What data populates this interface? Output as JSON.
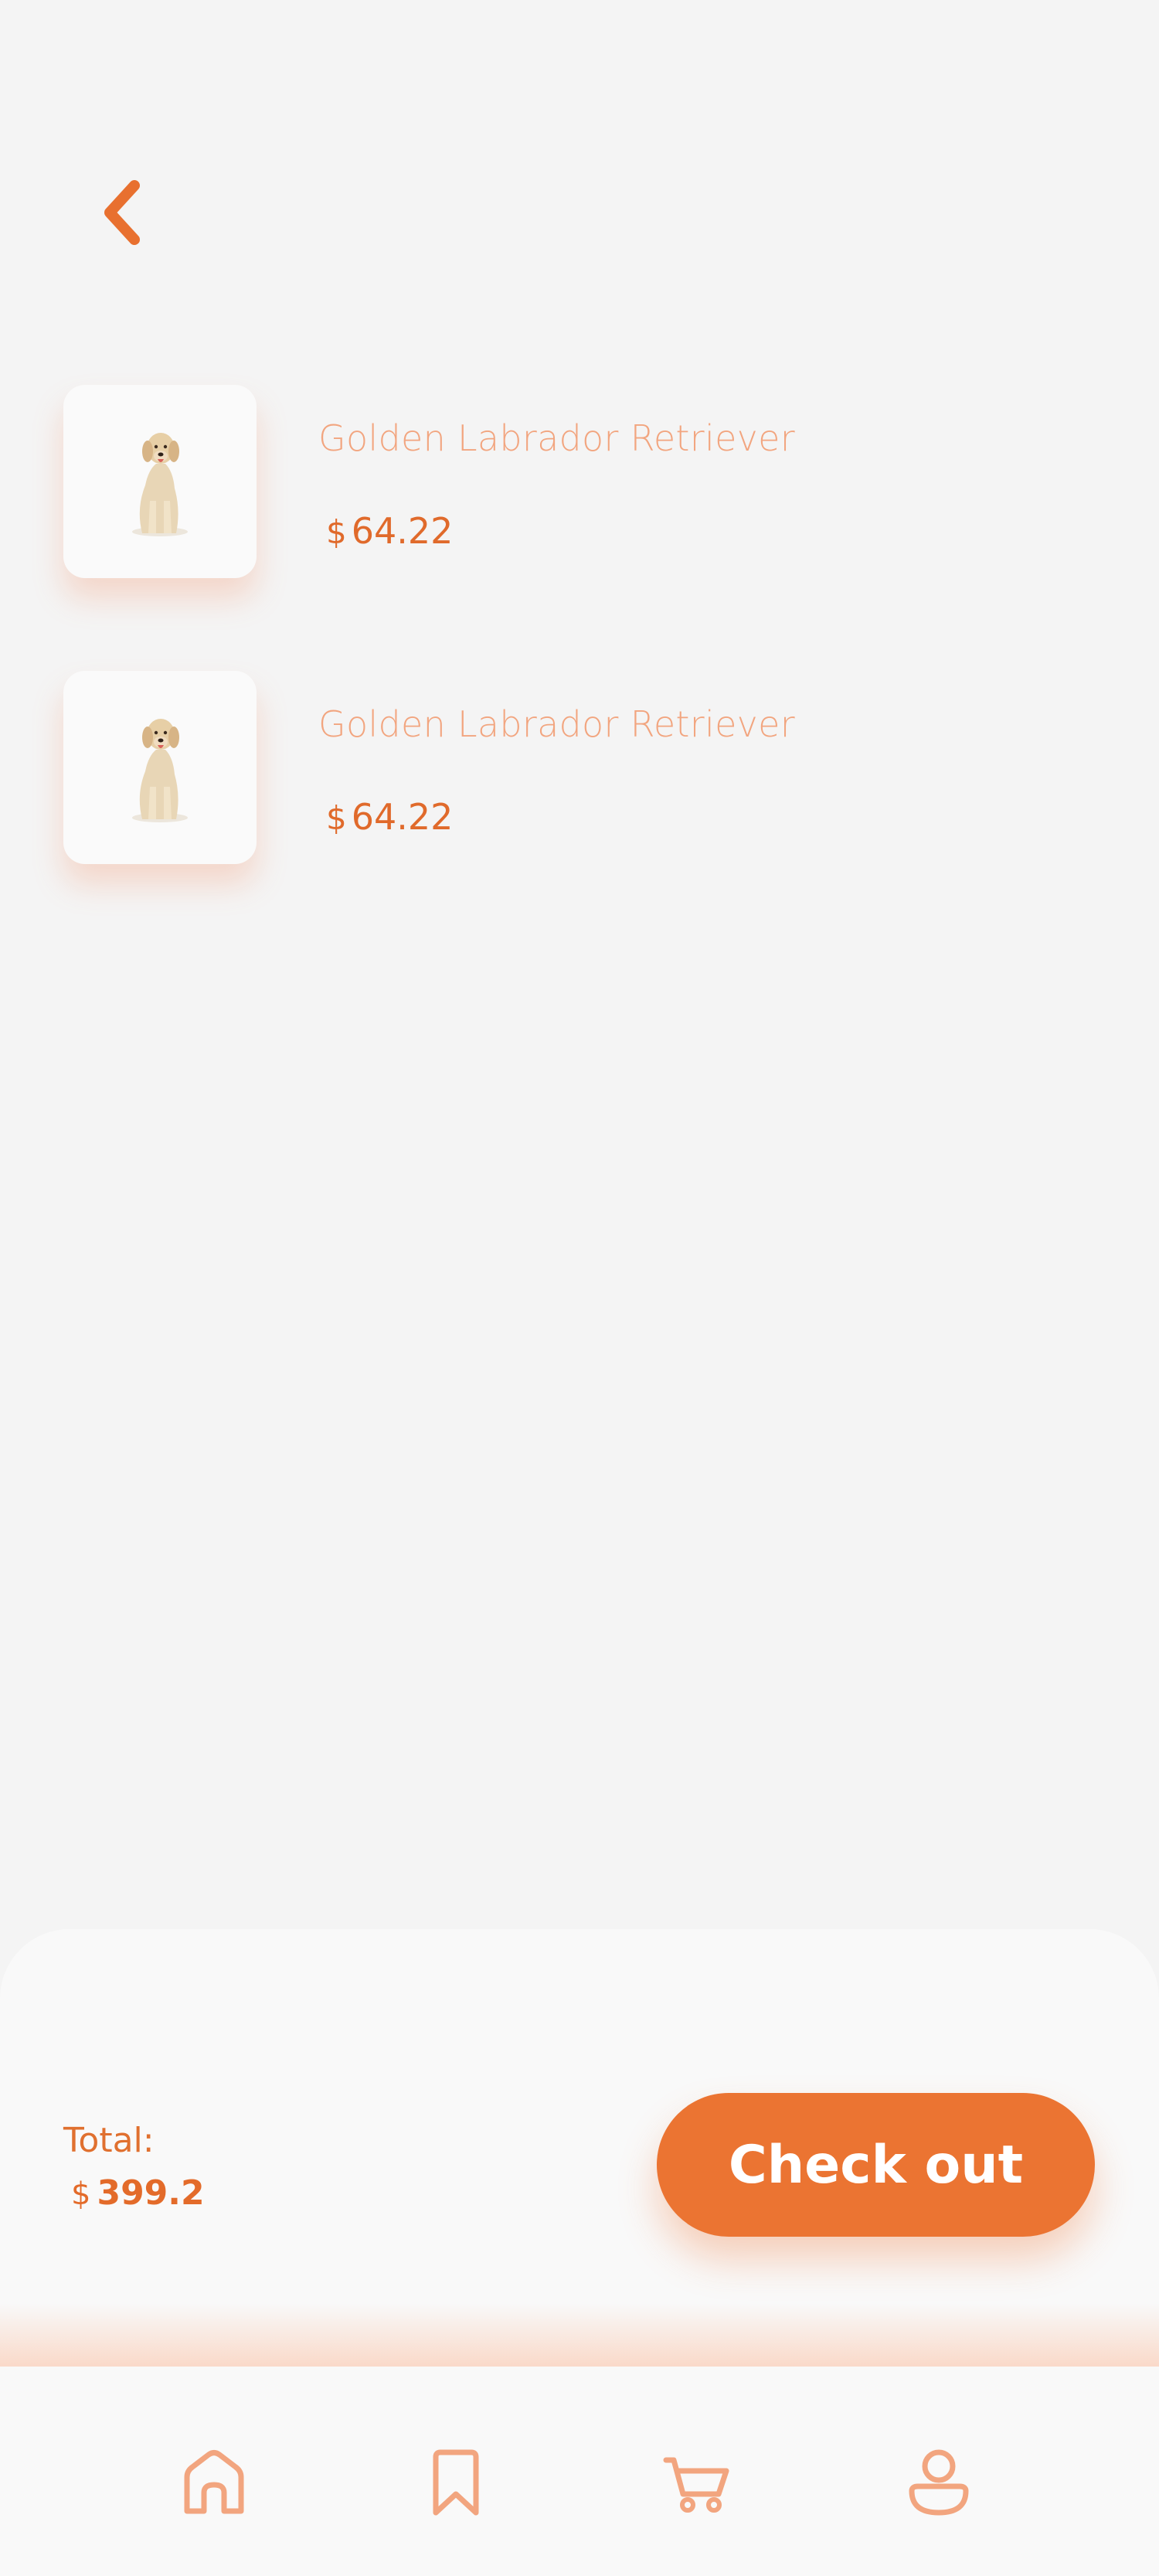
{
  "header": {
    "back_icon": "chevron-left-icon"
  },
  "cart": {
    "items": [
      {
        "name": "Golden Labrador Retriever",
        "currency": "$",
        "price": "64.22",
        "image": "golden-retriever-photo"
      },
      {
        "name": "Golden Labrador Retriever",
        "currency": "$",
        "price": "64.22",
        "image": "golden-retriever-photo"
      }
    ]
  },
  "summary": {
    "total_label": "Total:",
    "currency": "$",
    "total_value": "399.2",
    "checkout_label": "Check out"
  },
  "nav": {
    "items": [
      {
        "icon": "home-icon"
      },
      {
        "icon": "bookmark-icon"
      },
      {
        "icon": "cart-icon"
      },
      {
        "icon": "profile-icon"
      }
    ]
  },
  "colors": {
    "accent": "#eb7432",
    "accent_light": "#f2a57f",
    "background": "#f4f4f4",
    "panel": "#f9f9f9"
  }
}
